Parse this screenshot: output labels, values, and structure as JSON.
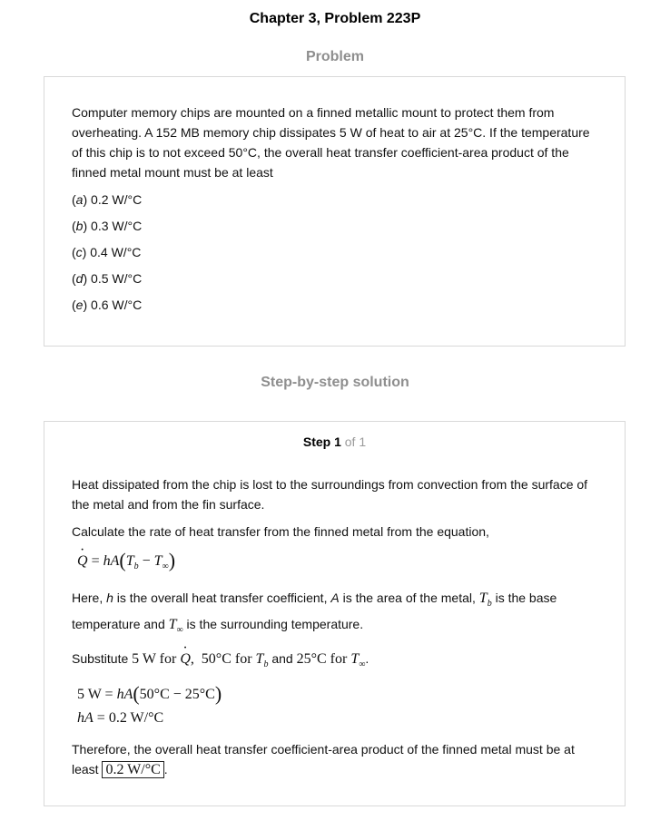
{
  "header": {
    "title": "Chapter 3, Problem 223P"
  },
  "problem": {
    "heading": "Problem",
    "text": "Computer memory chips are mounted on a finned metallic mount to protect them from overheating. A 152 MB memory chip dissipates 5 W of heat to air at 25°C. If the temperature of this chip is to not exceed 50°C, the overall heat transfer coefficient-area product of the finned metal mount must be at least",
    "options": [
      {
        "letter": "a",
        "value": "0.2 W/°C"
      },
      {
        "letter": "b",
        "value": " 0.3 W/°C"
      },
      {
        "letter": "c",
        "value": "0.4 W/°C"
      },
      {
        "letter": "d",
        "value": "0.5 W/°C"
      },
      {
        "letter": "e",
        "value": "0.6 W/°C"
      }
    ]
  },
  "solution": {
    "heading": "Step-by-step solution",
    "step_label": "Step 1",
    "step_of": "of 1",
    "para1": "Heat dissipated from the chip is lost to the surroundings from convection from the surface of the metal and from the fin surface.",
    "para2": "Calculate the rate of heat transfer from the finned metal from the equation,",
    "para3_a": "Here, ",
    "para3_h": "h",
    "para3_b": " is the overall heat transfer coefficient, ",
    "para3_A": "A",
    "para3_c": " is the area of the metal, ",
    "para3_d": " is the base temperature and ",
    "para3_e": " is the surrounding temperature.",
    "substitute_label": "Substitute",
    "sub_5w": "5 W for",
    "sub_50": "50°C for",
    "sub_and": "and",
    "sub_25": "25°C for",
    "eq1_lhs": "5 W",
    "eq1_rhs": "50°C − 25°C",
    "eq2": "0.2 W/°C",
    "conclusion": "Therefore, the overall heat transfer coefficient-area product of the finned metal must be at least",
    "answer": "0.2 W/°C"
  }
}
